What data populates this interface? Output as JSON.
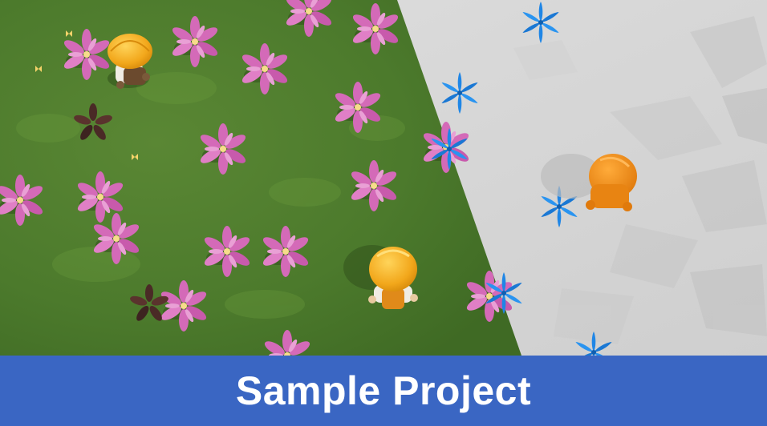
{
  "banner": {
    "title": "Sample Project"
  },
  "scene": {
    "characters": [
      {
        "name": "worker-yellow-hat",
        "color": "#f2a71b"
      },
      {
        "name": "worker-yellow-hat",
        "color": "#f2a71b"
      },
      {
        "name": "worker-orange-ghost",
        "color": "#f08a14"
      }
    ],
    "colors": {
      "grass": "#4f7a2e",
      "stone": "#d9d9d9",
      "pink_flower": "#d46ab8",
      "blue_flower": "#1f86e6",
      "banner": "#3a66c3"
    }
  }
}
